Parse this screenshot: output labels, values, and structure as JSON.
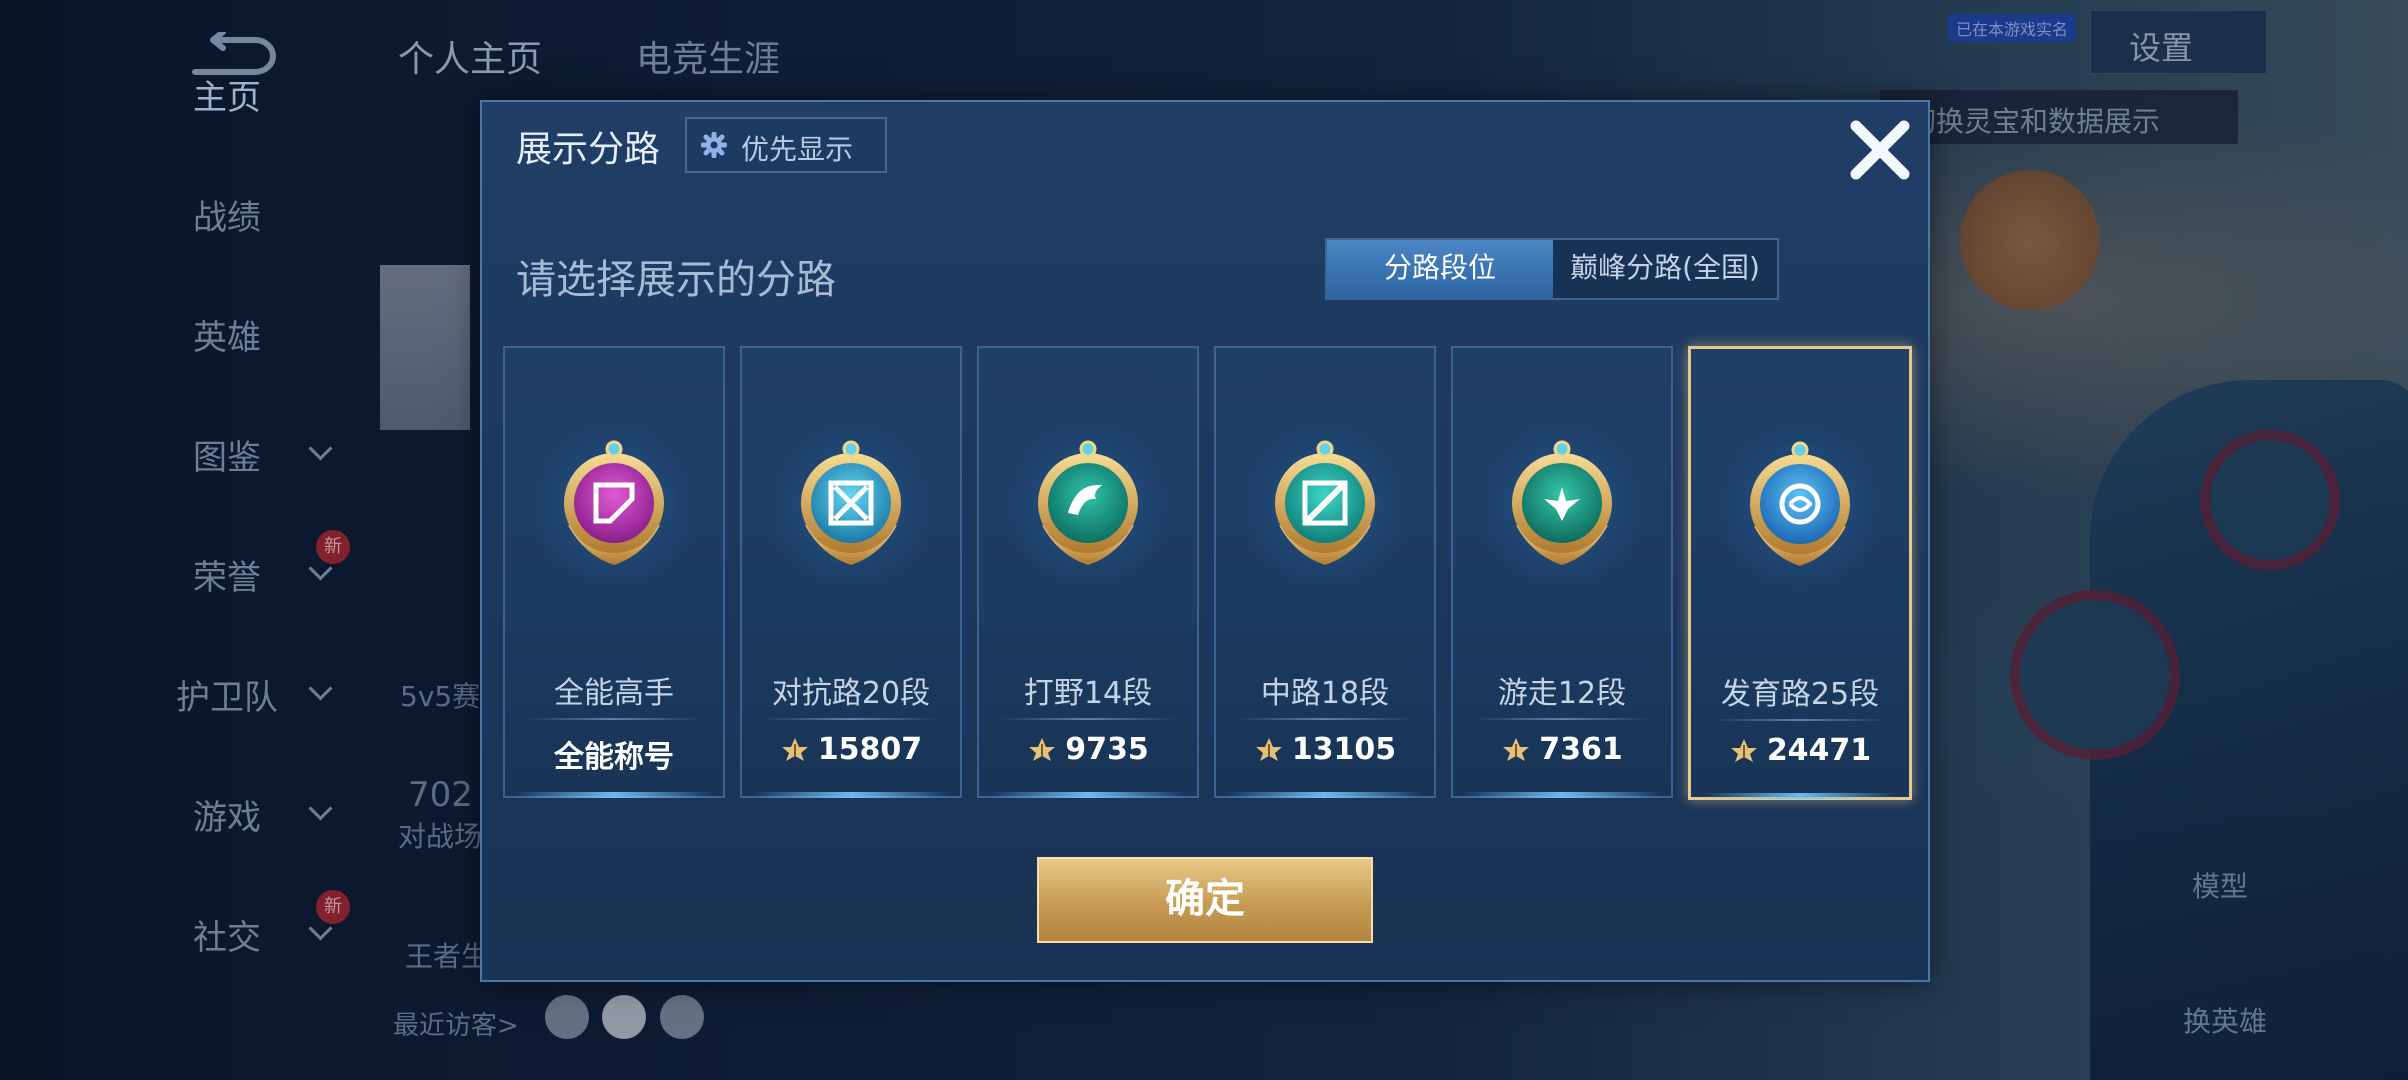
{
  "top_tabs": [
    "个人主页",
    "电竞生涯"
  ],
  "sidebar": {
    "items": [
      {
        "label": "主页",
        "chevron": false,
        "is_new": false,
        "active": true
      },
      {
        "label": "战绩",
        "chevron": false,
        "is_new": false,
        "active": false
      },
      {
        "label": "英雄",
        "chevron": false,
        "is_new": false,
        "active": false
      },
      {
        "label": "图鉴",
        "chevron": true,
        "is_new": false,
        "active": false
      },
      {
        "label": "荣誉",
        "chevron": true,
        "is_new": true,
        "active": false
      },
      {
        "label": "护卫队",
        "chevron": true,
        "is_new": false,
        "active": false
      },
      {
        "label": "游戏",
        "chevron": true,
        "is_new": false,
        "active": false
      },
      {
        "label": "社交",
        "chevron": true,
        "is_new": true,
        "active": false
      }
    ],
    "new_badge": "新"
  },
  "background": {
    "rank_label": "5v5赛",
    "number_partial": "702",
    "number_label": "对战场",
    "king_label": "王者生",
    "recent_visitors": "最近访客>",
    "model_label": "模型",
    "switch_hero_label": "换英雄"
  },
  "header": {
    "settings_label": "设置",
    "tip_tag": "已在本游戏实名",
    "tip_text": "以切换灵宝和数据展示"
  },
  "dialog": {
    "title": "展示分路",
    "priority_label": "优先显示",
    "subtitle": "请选择展示的分路",
    "tabs": [
      {
        "label": "分路段位",
        "selected": true
      },
      {
        "label": "巅峰分路(全国)",
        "selected": false
      }
    ],
    "lanes": [
      {
        "name": "全能高手",
        "score": "全能称号",
        "badge": "magenta-badge-icon",
        "has_points": false,
        "selected": false
      },
      {
        "name": "对抗路20段",
        "score": "15807",
        "badge": "clash-lane-badge-icon",
        "has_points": true,
        "selected": false
      },
      {
        "name": "打野14段",
        "score": "9735",
        "badge": "jungle-badge-icon",
        "has_points": true,
        "selected": false
      },
      {
        "name": "中路18段",
        "score": "13105",
        "badge": "mid-lane-badge-icon",
        "has_points": true,
        "selected": false
      },
      {
        "name": "游走12段",
        "score": "7361",
        "badge": "roam-badge-icon",
        "has_points": true,
        "selected": false
      },
      {
        "name": "发育路25段",
        "score": "24471",
        "badge": "farm-lane-badge-icon",
        "has_points": true,
        "selected": true
      }
    ],
    "confirm_label": "确定"
  },
  "colors": {
    "accent_gold": "#d9b66a",
    "dialog_bg": "#1f3b62",
    "selected_tab": "#3a76b8"
  }
}
